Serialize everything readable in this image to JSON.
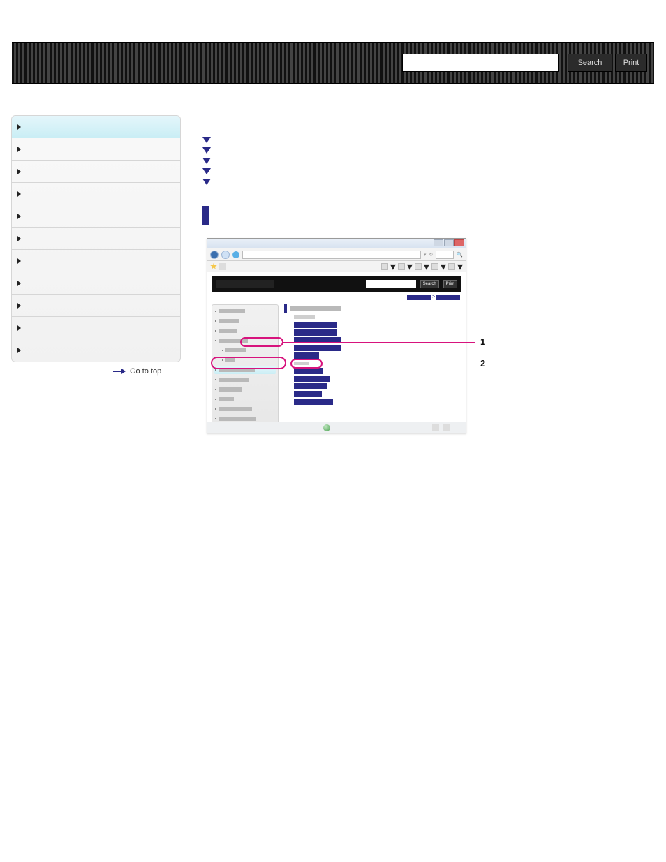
{
  "topbar": {
    "search_placeholder": "",
    "search_label": "Search",
    "print_label": "Print"
  },
  "sidebar": {
    "items": [
      {
        "label": ""
      },
      {
        "label": ""
      },
      {
        "label": ""
      },
      {
        "label": ""
      },
      {
        "label": ""
      },
      {
        "label": ""
      },
      {
        "label": ""
      },
      {
        "label": ""
      },
      {
        "label": ""
      },
      {
        "label": ""
      },
      {
        "label": ""
      }
    ],
    "goto_top": "Go to top"
  },
  "main": {
    "title": "",
    "anchors": [
      {
        "label": ""
      },
      {
        "label": ""
      },
      {
        "label": ""
      },
      {
        "label": ""
      },
      {
        "label": ""
      }
    ],
    "section_title": "",
    "lead_text": ""
  },
  "illus": {
    "search_btn": "Search",
    "print_btn": "Print",
    "callouts": {
      "one": "1",
      "two": "2"
    }
  }
}
